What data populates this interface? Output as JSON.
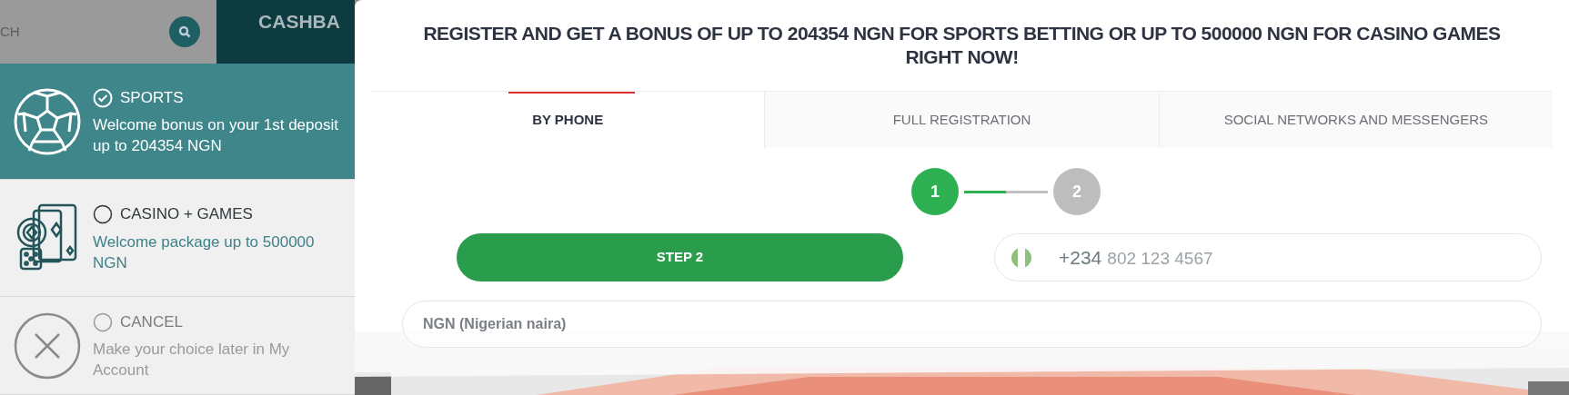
{
  "background": {
    "search": {
      "placeholder": "CH"
    },
    "banner_title": "CASHBA"
  },
  "bonus_options": [
    {
      "kind": "sports",
      "title": "SPORTS",
      "description": "Welcome bonus on your 1st deposit up to 204354 NGN",
      "selected": true
    },
    {
      "kind": "casino",
      "title": "CASINO + GAMES",
      "description": "Welcome package up to 500000 NGN",
      "selected": false
    },
    {
      "kind": "cancel",
      "title": "CANCEL",
      "description": "Make your choice later in My Account",
      "selected": false
    }
  ],
  "modal": {
    "title": "REGISTER AND GET A BONUS OF UP TO 204354 NGN FOR SPORTS BETTING OR UP TO 500000 NGN FOR CASINO GAMES RIGHT NOW!",
    "tabs": [
      {
        "label": "BY PHONE",
        "selected": true
      },
      {
        "label": "FULL REGISTRATION",
        "selected": false
      },
      {
        "label": "SOCIAL NETWORKS AND MESSENGERS",
        "selected": false
      }
    ],
    "steps": [
      {
        "label": "1",
        "selected": true
      },
      {
        "label": "2",
        "selected": false
      }
    ],
    "step_progress": {
      "level": 0.5
    },
    "step_button": "STEP 2",
    "phone": {
      "prefix": "+234",
      "placeholder": "802 123 4567"
    },
    "currency": {
      "value": "NGN (Nigerian naira)"
    }
  }
}
